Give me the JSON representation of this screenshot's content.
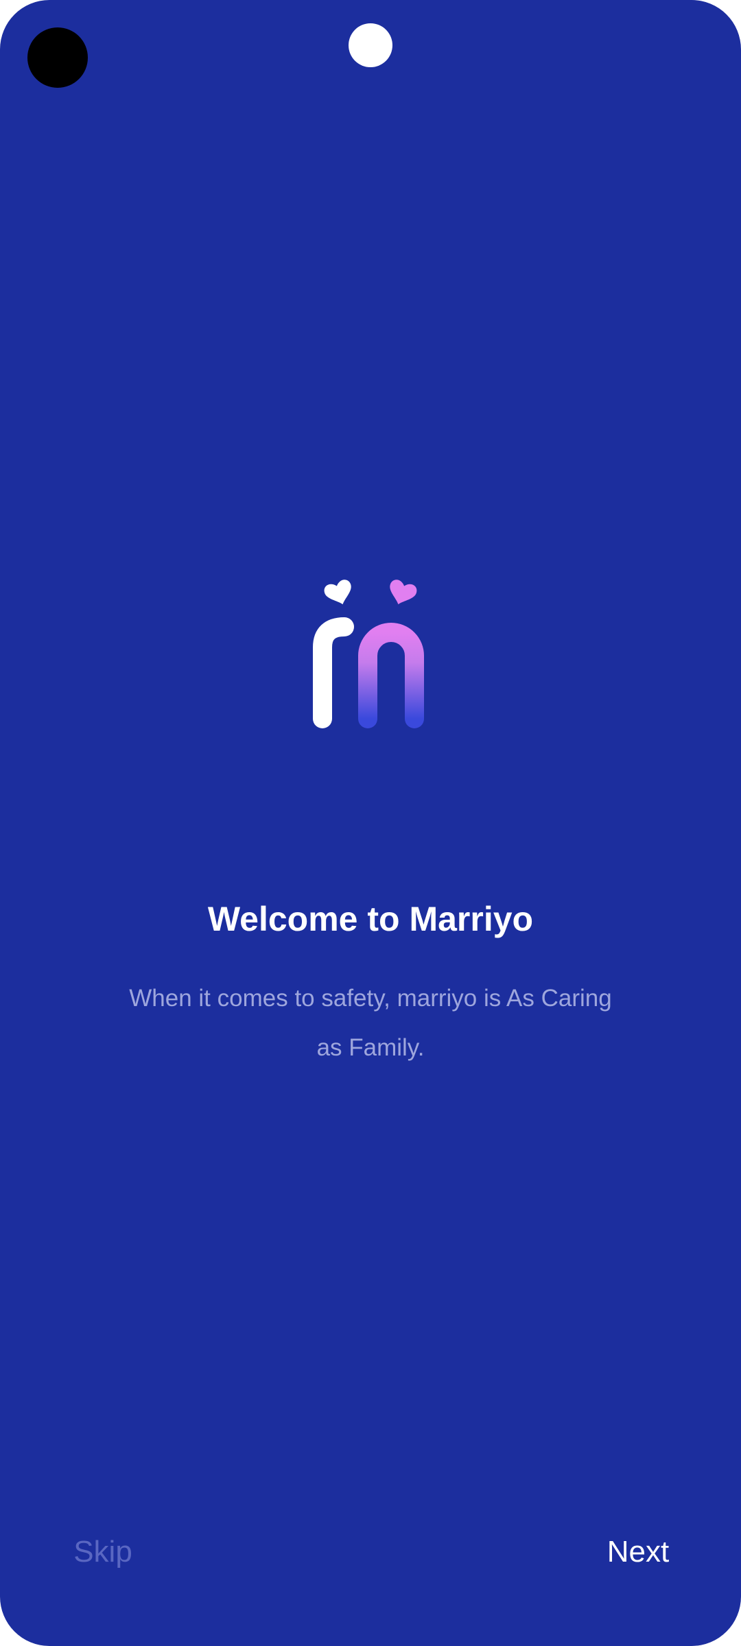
{
  "onboarding": {
    "title": "Welcome to Marriyo",
    "description": "When it comes to safety, marriyo is As Caring as Family."
  },
  "logo": {
    "icon": "marriyo-m-logo-with-hearts",
    "colors": {
      "white": "#ffffff",
      "pink": "#e17ff0",
      "blue": "#3a49dc"
    }
  },
  "navigation": {
    "skip_label": "Skip",
    "next_label": "Next"
  },
  "theme": {
    "background": "#1c2e9e",
    "title_color": "#ffffff",
    "description_color": "#9ea6dd",
    "skip_color": "#5a67c2",
    "next_color": "#ffffff"
  }
}
